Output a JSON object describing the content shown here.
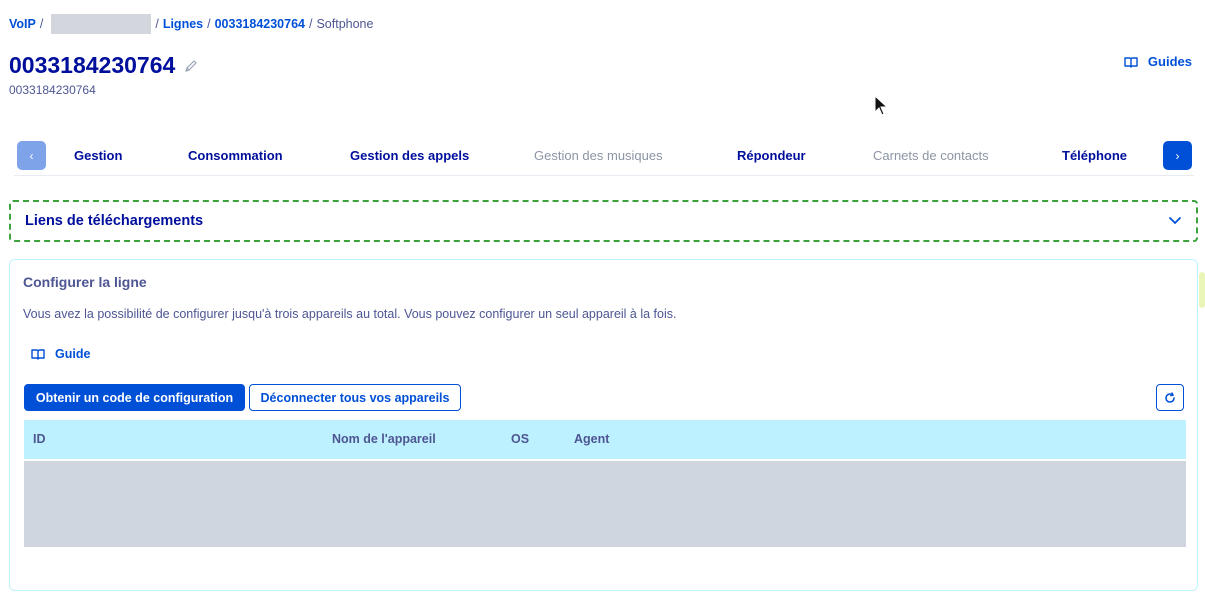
{
  "breadcrumb": {
    "voip": "VoIP",
    "lignes": "Lignes",
    "line_number": "0033184230764",
    "current": "Softphone"
  },
  "header": {
    "title": "0033184230764",
    "subtitle": "0033184230764",
    "guides_label": "Guides"
  },
  "tabs": [
    {
      "label": "Gestion",
      "disabled": false
    },
    {
      "label": "Consommation",
      "disabled": false
    },
    {
      "label": "Gestion des appels",
      "disabled": false
    },
    {
      "label": "Gestion des musiques",
      "disabled": true
    },
    {
      "label": "Répondeur",
      "disabled": false
    },
    {
      "label": "Carnets de contacts",
      "disabled": true
    },
    {
      "label": "Téléphone",
      "disabled": false
    }
  ],
  "accordion": {
    "title": "Liens de téléchargements"
  },
  "config": {
    "title": "Configurer la ligne",
    "description": "Vous avez la possibilité de configurer jusqu'à trois appareils au total. Vous pouvez configurer un seul appareil à la fois.",
    "guide_label": "Guide",
    "primary_button": "Obtenir un code de configuration",
    "secondary_button": "Déconnecter tous vos appareils"
  },
  "table": {
    "columns": [
      "ID",
      "Nom de l'appareil",
      "OS",
      "Agent"
    ],
    "rows": []
  },
  "colors": {
    "primary": "#0050d7",
    "title": "#000e9c",
    "text": "#4d5693",
    "table_header": "#bef1ff",
    "accordion_focus": "#3ca23c"
  }
}
